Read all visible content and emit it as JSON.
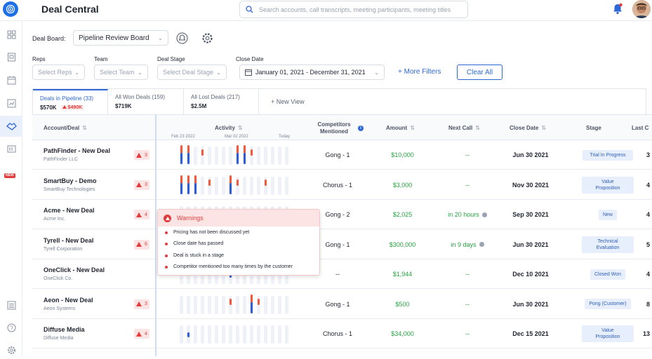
{
  "app": {
    "title": "Deal Central"
  },
  "search": {
    "placeholder": "Search accounts, call transcripts, meeting participants, meeting titles"
  },
  "board": {
    "label": "Deal Board:",
    "value": "Pipeline Review Board"
  },
  "filters": {
    "reps": {
      "label": "Reps",
      "placeholder": "Select Reps"
    },
    "team": {
      "label": "Team",
      "placeholder": "Select Team"
    },
    "stage": {
      "label": "Deal Stage",
      "placeholder": "Select Deal Stage"
    },
    "close": {
      "label": "Close Date",
      "value": "January 01, 2021 - December 31, 2021"
    },
    "more": "+ More Filters",
    "clear": "Clear All"
  },
  "sidebar": {
    "new_badge": "NEW"
  },
  "tabs": [
    {
      "label": "Deals in Pipeline",
      "count": "(33)",
      "amount": "$570K",
      "warn": "$490K"
    },
    {
      "label": "All Won Deals",
      "count": "(159)",
      "amount": "$719K"
    },
    {
      "label": "All Lost Deals",
      "count": "(217)",
      "amount": "$2.5M"
    }
  ],
  "new_view": "+   New View",
  "columns": {
    "account": "Account/Deal",
    "activity": "Activity",
    "competitors": "Competitors Mentioned",
    "amount": "Amount",
    "next_call": "Next Call",
    "close_date": "Close Date",
    "stage": "Stage",
    "last": "Last C"
  },
  "activity_dates": {
    "d1": "Feb 23 2022",
    "d2": "Mar 02 2022",
    "d3": "Today"
  },
  "rows": [
    {
      "name": "PathFinder - New Deal",
      "company": "PathFinder LLC",
      "warnings": "3",
      "competitors": "Gong - 1",
      "amount": "$10,000",
      "next_call": "--",
      "close_date": "Jun 30 2021",
      "stage": "Trial In Progress",
      "last": "3"
    },
    {
      "name": "SmartBuy - Demo",
      "company": "SmartBuy Technologies",
      "warnings": "3",
      "competitors": "Chorus - 1",
      "amount": "$3,000",
      "next_call": "--",
      "close_date": "Nov 30 2021",
      "stage": "Value Proposition",
      "last": "4"
    },
    {
      "name": "Acme - New Deal",
      "company": "Acme Inc.",
      "warnings": "4",
      "competitors": "Gong - 2",
      "amount": "$2,025",
      "next_call": "in 20 hours",
      "close_date": "Sep 30 2021",
      "stage": "New",
      "last": "4"
    },
    {
      "name": "Tyrell - New Deal",
      "company": "Tyrell Corporation",
      "warnings": "6",
      "competitors": "Gong - 1",
      "amount": "$300,000",
      "next_call": "in 9 days",
      "close_date": "Jun 30 2021",
      "stage": "Technical Evaluation",
      "last": "5"
    },
    {
      "name": "OneClick - New Deal",
      "company": "OneClick Co.",
      "warnings": "",
      "competitors": "--",
      "amount": "$1,944",
      "next_call": "--",
      "close_date": "Dec 10 2021",
      "stage": "Closed Won",
      "last": "4"
    },
    {
      "name": "Aeon - New Deal",
      "company": "Aeon Systems",
      "warnings": "3",
      "competitors": "Gong - 1",
      "amount": "$500",
      "next_call": "--",
      "close_date": "Jun 30 2021",
      "stage": "Pong (Customer)",
      "last": "8"
    },
    {
      "name": "Diffuse Media",
      "company": "Diffuse Media",
      "warnings": "4",
      "competitors": "Chorus - 1",
      "amount": "$34,000",
      "next_call": "--",
      "close_date": "Dec 15 2021",
      "stage": "Value Proposition",
      "last": "13"
    }
  ],
  "popover": {
    "title": "Warnings",
    "items": [
      "Pricing has not been discussed yet",
      "Close date has passed",
      "Deal is stuck in a stage",
      "Competitor mentioned too many times by the customer"
    ]
  },
  "colors": {
    "accent": "#2e68d6",
    "warn": "#e23d3d",
    "green": "#27a341"
  }
}
